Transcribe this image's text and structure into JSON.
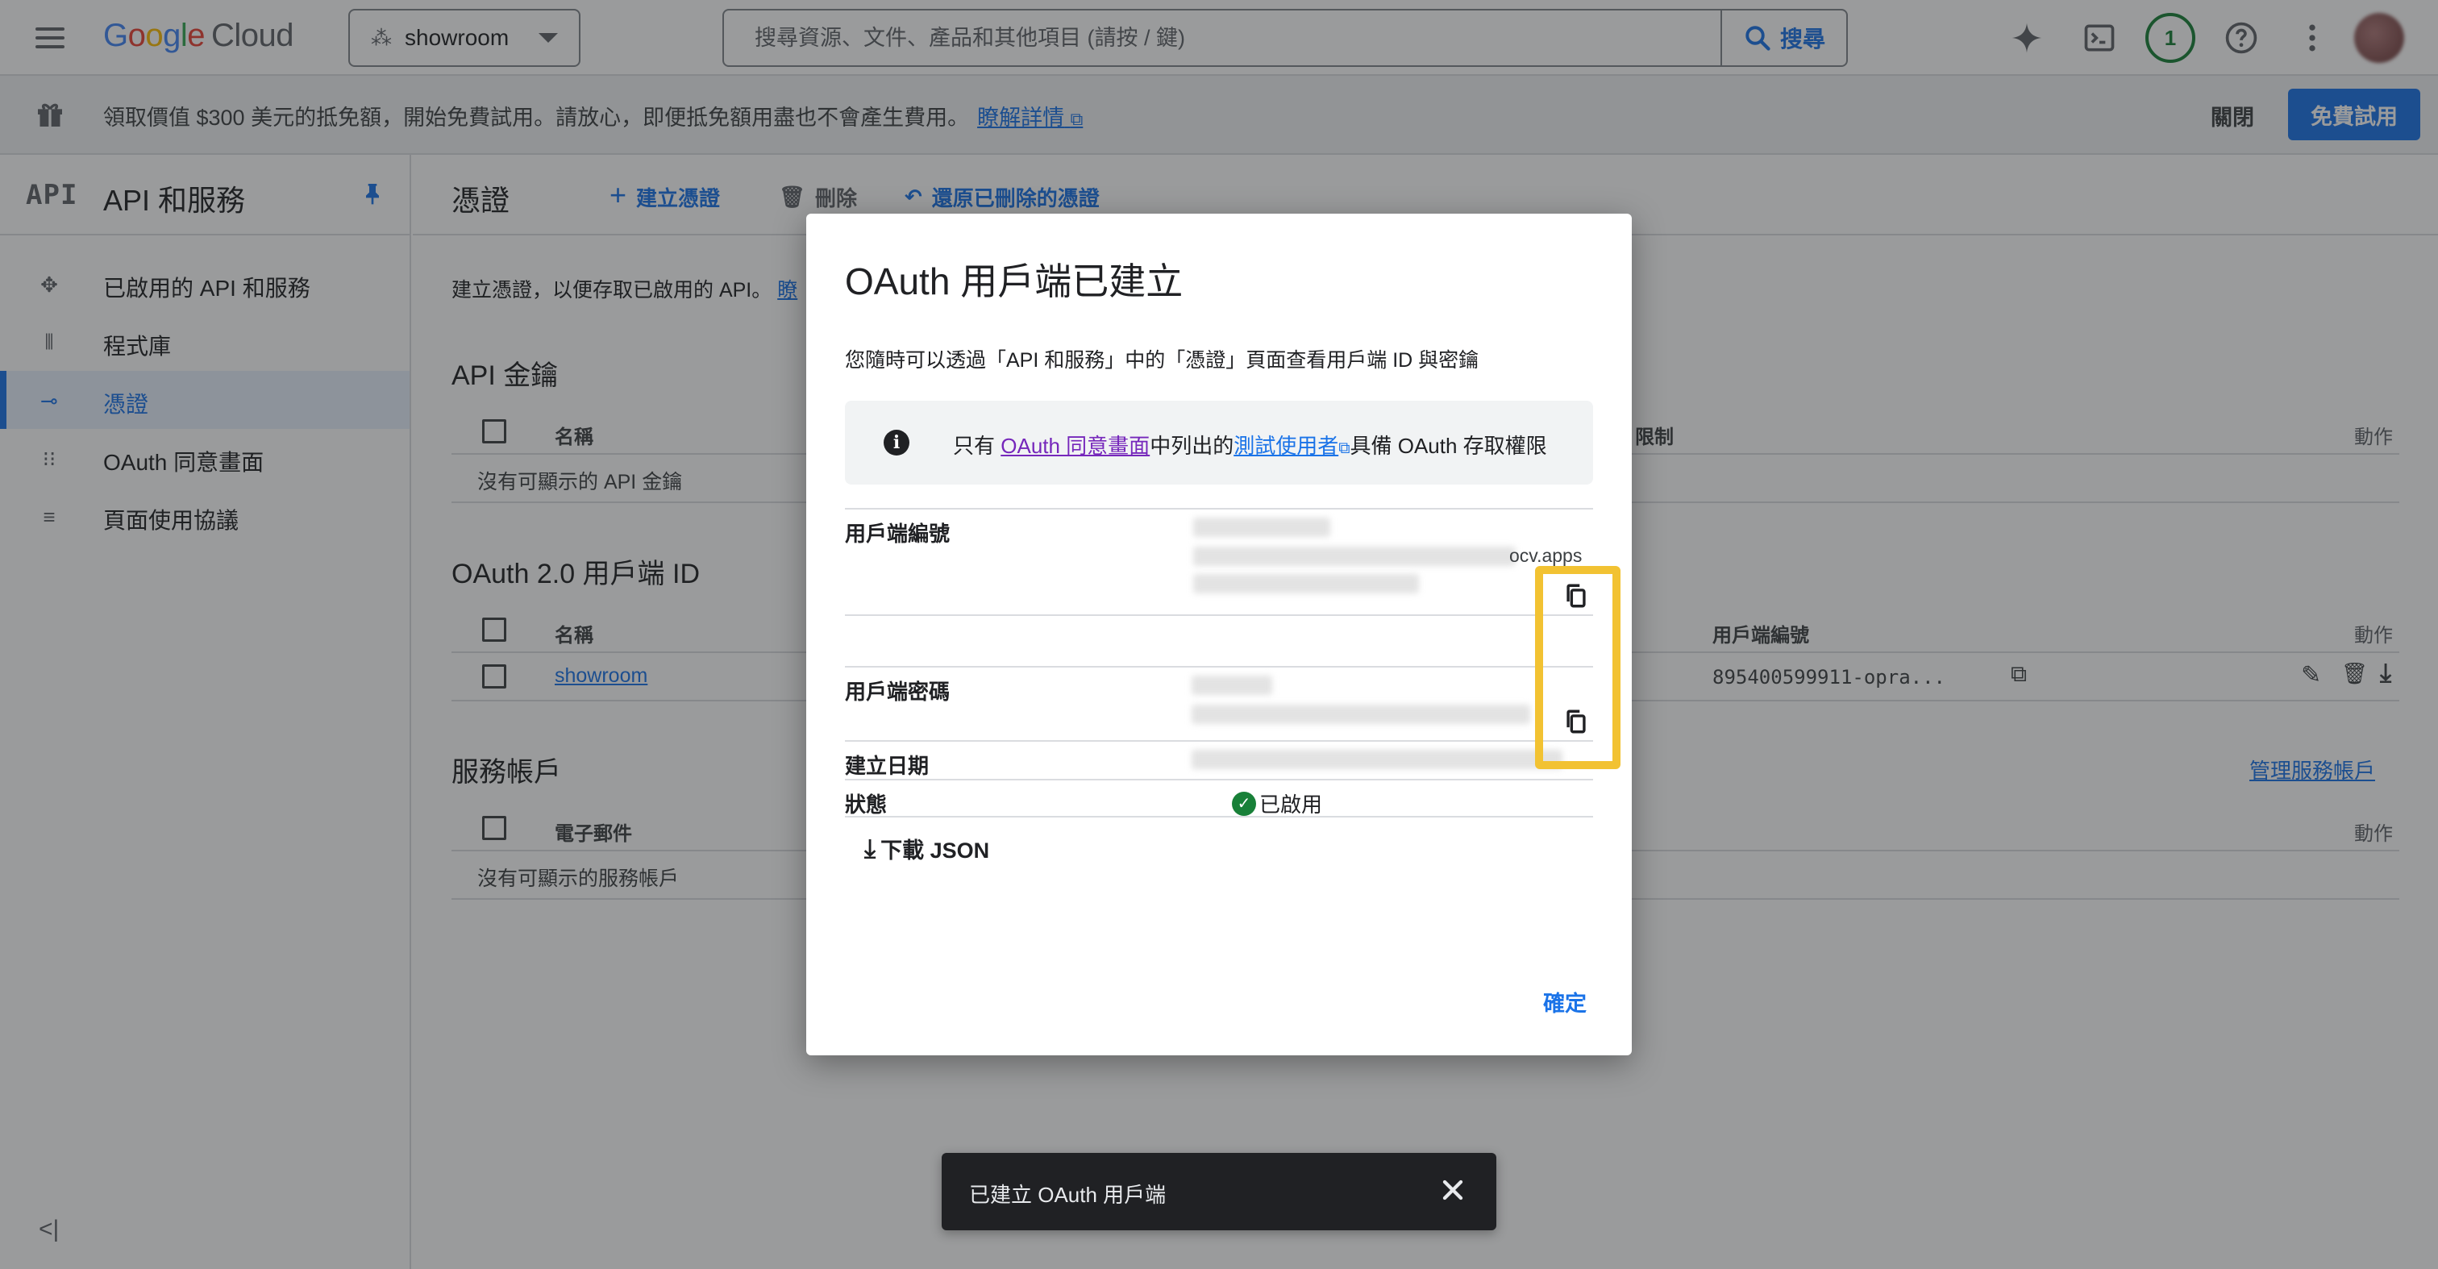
{
  "header": {
    "logo_google": "Google",
    "logo_cloud": "Cloud",
    "project": "showroom",
    "search_placeholder": "搜尋資源、文件、產品和其他項目 (請按 / 鍵)",
    "search_button": "搜尋",
    "notifications_count": "1"
  },
  "promo": {
    "text": "領取價值 $300 美元的抵免額，開始免費試用。請放心，即便抵免額用盡也不會產生費用。",
    "learn_more": "瞭解詳情",
    "close": "關閉",
    "trial_button": "免費試用"
  },
  "nav": {
    "logo": "API",
    "title": "API 和服務",
    "items": [
      {
        "label": "已啟用的 API 和服務",
        "icon": "enabled-apis-icon"
      },
      {
        "label": "程式庫",
        "icon": "library-icon"
      },
      {
        "label": "憑證",
        "icon": "key-icon"
      },
      {
        "label": "OAuth 同意畫面",
        "icon": "consent-icon"
      },
      {
        "label": "頁面使用協議",
        "icon": "agreement-icon"
      }
    ],
    "collapse": "<|"
  },
  "main": {
    "page_title": "憑證",
    "create": "建立憑證",
    "delete": "刪除",
    "restore": "還原已刪除的憑證",
    "description": "建立憑證，以便存取已啟用的 API。",
    "description_link": "瞭",
    "api_keys": {
      "title": "API 金鑰",
      "col_name": "名稱",
      "col_restrictions": "限制",
      "col_actions": "動作",
      "empty": "沒有可顯示的 API 金鑰"
    },
    "oauth": {
      "title": "OAuth 2.0 用戶端 ID",
      "col_name": "名稱",
      "col_client_id": "用戶端編號",
      "col_actions": "動作",
      "rows": [
        {
          "name": "showroom",
          "client_id": "895400599911-opra..."
        }
      ]
    },
    "service_accounts": {
      "title": "服務帳戶",
      "manage": "管理服務帳戶",
      "col_email": "電子郵件",
      "col_actions": "動作",
      "empty": "沒有可顯示的服務帳戶"
    }
  },
  "dialog": {
    "title": "OAuth 用戶端已建立",
    "subtitle": "您隨時可以透過「API 和服務」中的「憑證」頁面查看用戶端 ID 與密鑰",
    "notice_prefix": "只有",
    "notice_link1": "OAuth 同意畫面",
    "notice_mid": "中列出的",
    "notice_link2": "測試使用者",
    "notice_suffix": "具備 OAuth 存取權限",
    "client_id_label": "用戶端編號",
    "client_id_visible_tail": "ocv.apps",
    "client_secret_label": "用戶端密碼",
    "created_label": "建立日期",
    "status_label": "狀態",
    "status_value": "已啟用",
    "download": "下載 JSON",
    "ok": "確定"
  },
  "snackbar": {
    "text": "已建立 OAuth 用戶端"
  },
  "colors": {
    "accent": "#1a73e8",
    "highlight": "#f2c232",
    "success": "#188038"
  }
}
